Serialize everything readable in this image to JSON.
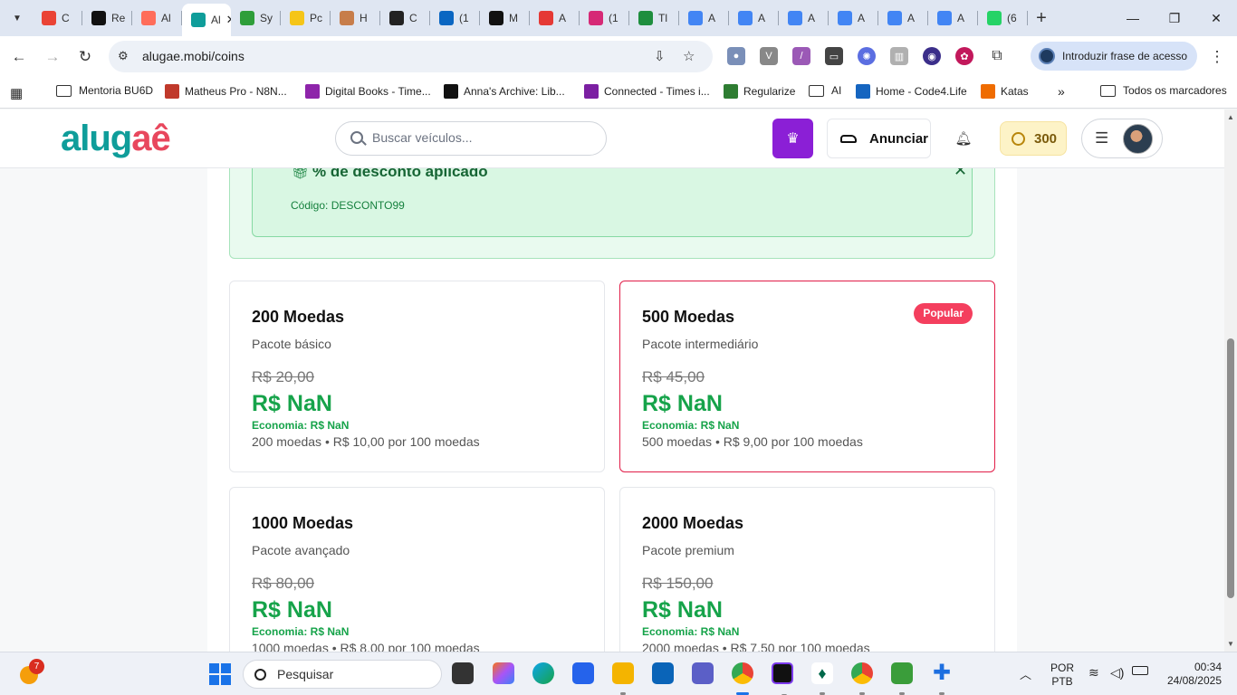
{
  "browser": {
    "tabs": [
      {
        "label": "C",
        "icon": "gmail-icon",
        "color": "#ea4335"
      },
      {
        "label": "Re",
        "icon": "r-icon",
        "color": "#111111"
      },
      {
        "label": "Al",
        "icon": "n8n-icon",
        "color": "#ff6d5a"
      },
      {
        "label": "Al",
        "icon": "alugae-icon",
        "color": "#0f9d9a",
        "active": true
      },
      {
        "label": "Sy",
        "icon": "green-circle-icon",
        "color": "#2e9e3a"
      },
      {
        "label": "Pc",
        "icon": "m-icon",
        "color": "#f5c518"
      },
      {
        "label": "H",
        "icon": "box-icon",
        "color": "#c77d4a"
      },
      {
        "label": "C",
        "icon": "z-icon",
        "color": "#222222"
      },
      {
        "label": "(1",
        "icon": "diamond-icon",
        "color": "#0a66c2"
      },
      {
        "label": "M",
        "icon": "rog-icon",
        "color": "#111111"
      },
      {
        "label": "A",
        "icon": "person-icon",
        "color": "#e53935"
      },
      {
        "label": "(1",
        "icon": "instagram-icon",
        "color": "#d62976"
      },
      {
        "label": "Tl",
        "icon": "drive-icon",
        "color": "#1e8e3e"
      },
      {
        "label": "A",
        "icon": "docs-icon",
        "color": "#4285f4"
      },
      {
        "label": "A",
        "icon": "docs-icon",
        "color": "#4285f4"
      },
      {
        "label": "A",
        "icon": "docs-icon",
        "color": "#4285f4"
      },
      {
        "label": "A",
        "icon": "docs-icon",
        "color": "#4285f4"
      },
      {
        "label": "A",
        "icon": "docs-icon",
        "color": "#4285f4"
      },
      {
        "label": "A",
        "icon": "docs-icon",
        "color": "#4285f4"
      },
      {
        "label": "(6",
        "icon": "whatsapp-icon",
        "color": "#25d366"
      }
    ],
    "url": "alugae.mobi/coins",
    "passkey_label": "Introduzir frase de acesso",
    "bookmarks": [
      {
        "label": "Mentoria BU6D",
        "type": "folder"
      },
      {
        "label": "Matheus Pro - N8N...",
        "type": "site",
        "color": "#c0392b"
      },
      {
        "label": "Digital Books - Time...",
        "type": "site",
        "color": "#8e24aa"
      },
      {
        "label": "Anna's Archive: Lib...",
        "type": "site",
        "color": "#111111"
      },
      {
        "label": "Connected - Times i...",
        "type": "site",
        "color": "#7b1fa2"
      },
      {
        "label": "Regularize",
        "type": "site",
        "color": "#2e7d32"
      },
      {
        "label": "AI",
        "type": "folder"
      },
      {
        "label": "Home - Code4.Life",
        "type": "site",
        "color": "#1565c0"
      },
      {
        "label": "Katas",
        "type": "site",
        "color": "#ef6c00"
      }
    ],
    "all_bookmarks_label": "Todos os marcadores"
  },
  "site": {
    "logo_part1": "alug",
    "logo_part2": "aê",
    "search_placeholder": "Buscar veículos...",
    "advertise_label": "Anunciar",
    "coin_balance": "300",
    "accent_color": "#0f9d9a",
    "premium_color": "#8b1fd6"
  },
  "discount": {
    "title": "% de desconto aplicado",
    "code": "Código: DESCONTO99"
  },
  "packages": [
    {
      "title": "200 Moedas",
      "subtitle": "Pacote básico",
      "old_price": "R$ 20,00",
      "price": "R$ NaN",
      "savings": "Economia: R$ NaN",
      "detail": "200 moedas • R$ 10,00 por 100 moedas",
      "popular": false
    },
    {
      "title": "500 Moedas",
      "subtitle": "Pacote intermediário",
      "old_price": "R$ 45,00",
      "price": "R$ NaN",
      "savings": "Economia: R$ NaN",
      "detail": "500 moedas • R$ 9,00 por 100 moedas",
      "popular": true,
      "badge": "Popular"
    },
    {
      "title": "1000 Moedas",
      "subtitle": "Pacote avançado",
      "old_price": "R$ 80,00",
      "price": "R$ NaN",
      "savings": "Economia: R$ NaN",
      "detail": "1000 moedas • R$ 8,00 por 100 moedas",
      "popular": false
    },
    {
      "title": "2000 Moedas",
      "subtitle": "Pacote premium",
      "old_price": "R$ 150,00",
      "price": "R$ NaN",
      "savings": "Economia: R$ NaN",
      "detail": "2000 moedas • R$ 7,50 por 100 moedas",
      "popular": false
    }
  ],
  "taskbar": {
    "weather_badge": "7",
    "search_label": "Pesquisar",
    "language": "POR",
    "layout": "PTB",
    "time": "00:34",
    "date": "24/08/2025"
  }
}
